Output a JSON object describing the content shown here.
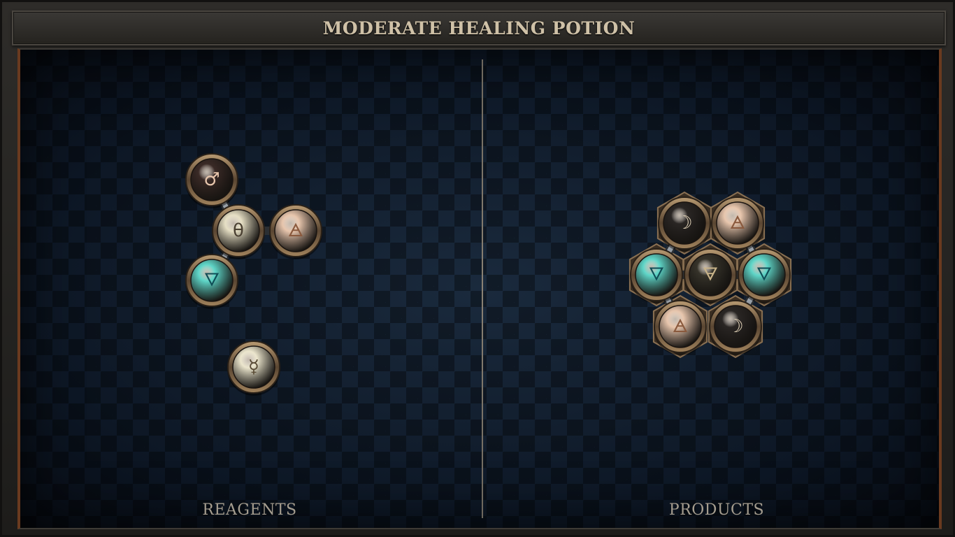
{
  "title": "MODERATE HEALING POTION",
  "sections": {
    "reagents_label": "REAGENTS",
    "products_label": "PRODUCTS"
  },
  "reagents": {
    "molecules": [
      {
        "nodes": [
          {
            "id": "r1",
            "symbol": "♂",
            "element": "iron"
          },
          {
            "id": "r2",
            "symbol": "θ",
            "element": "salt"
          },
          {
            "id": "r3",
            "symbol": "🜁",
            "element": "air"
          },
          {
            "id": "r4",
            "symbol": "🜄",
            "element": "water"
          }
        ],
        "bonds": [
          [
            "r1",
            "r2"
          ],
          [
            "r2",
            "r3"
          ],
          [
            "r2",
            "r4"
          ]
        ]
      },
      {
        "nodes": [
          {
            "id": "r5",
            "symbol": "☿",
            "element": "quicksilver"
          }
        ],
        "bonds": []
      }
    ]
  },
  "products": {
    "molecules": [
      {
        "nodes": [
          {
            "id": "p1",
            "symbol": "☽",
            "element": "silver"
          },
          {
            "id": "p2",
            "symbol": "🜁",
            "element": "air"
          },
          {
            "id": "p3",
            "symbol": "🜄",
            "element": "water"
          },
          {
            "id": "p4",
            "symbol": "🜃",
            "element": "earth"
          },
          {
            "id": "p5",
            "symbol": "🜄",
            "element": "water"
          },
          {
            "id": "p6",
            "symbol": "🜁",
            "element": "air"
          },
          {
            "id": "p7",
            "symbol": "☽",
            "element": "silver"
          }
        ],
        "bonds": [
          [
            "p1",
            "p3"
          ],
          [
            "p2",
            "p5"
          ],
          [
            "p3",
            "p4"
          ],
          [
            "p4",
            "p5"
          ],
          [
            "p3",
            "p6"
          ],
          [
            "p5",
            "p7"
          ]
        ]
      }
    ]
  },
  "element_colors": {
    "iron": "#3a2a26",
    "salt": "#e6dfc4",
    "air": "#e8c6ad",
    "water": "#5fd6c8",
    "quicksilver": "#ece6cd",
    "silver": "#2a2624",
    "earth": "#36332a"
  },
  "symbol_colors": {
    "iron": "#e8c6ad",
    "salt": "#4a4032",
    "air": "#8a5a3e",
    "water": "#0f4d56",
    "quicksilver": "#5a4c36",
    "silver": "#e6d6bb",
    "earth": "#c9b48a"
  }
}
